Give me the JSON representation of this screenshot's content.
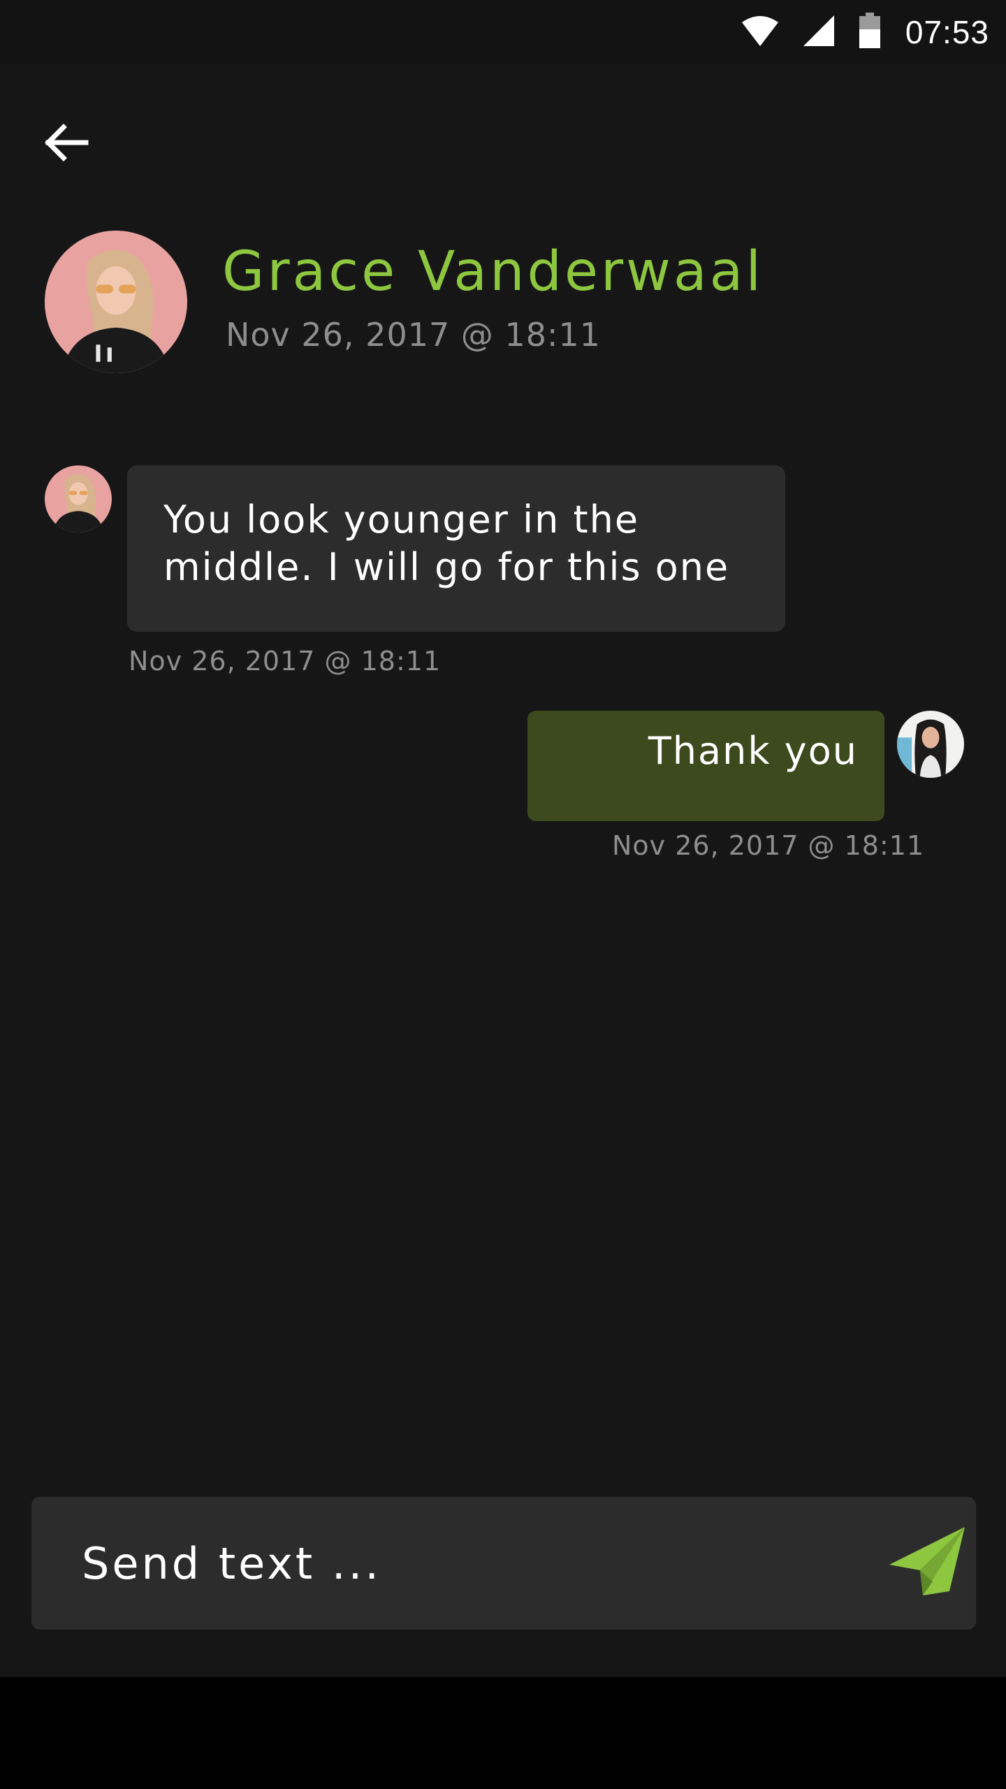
{
  "status_bar": {
    "time": "07:53",
    "icons": [
      "wifi-icon",
      "cellular-signal-icon",
      "battery-icon"
    ]
  },
  "header": {
    "back_icon": "arrow-left-icon",
    "contact_name": "Grace Vanderwaal",
    "contact_timestamp": "Nov 26, 2017 @ 18:11"
  },
  "messages": [
    {
      "direction": "incoming",
      "lines": [
        "You look younger in the",
        "middle. I will go for this one"
      ],
      "timestamp": "Nov 26, 2017 @ 18:11"
    },
    {
      "direction": "outgoing",
      "lines": [
        "Thank you"
      ],
      "timestamp": "Nov 26, 2017 @ 18:11"
    }
  ],
  "composer": {
    "placeholder": "Send text ...",
    "send_icon": "paper-plane-icon"
  },
  "colors": {
    "background": "#171617",
    "accent": "#8dc63f",
    "incoming_bubble": "#2d2c2d",
    "outgoing_bubble": "#3c4a1e",
    "muted_text": "#8f8e8f"
  }
}
